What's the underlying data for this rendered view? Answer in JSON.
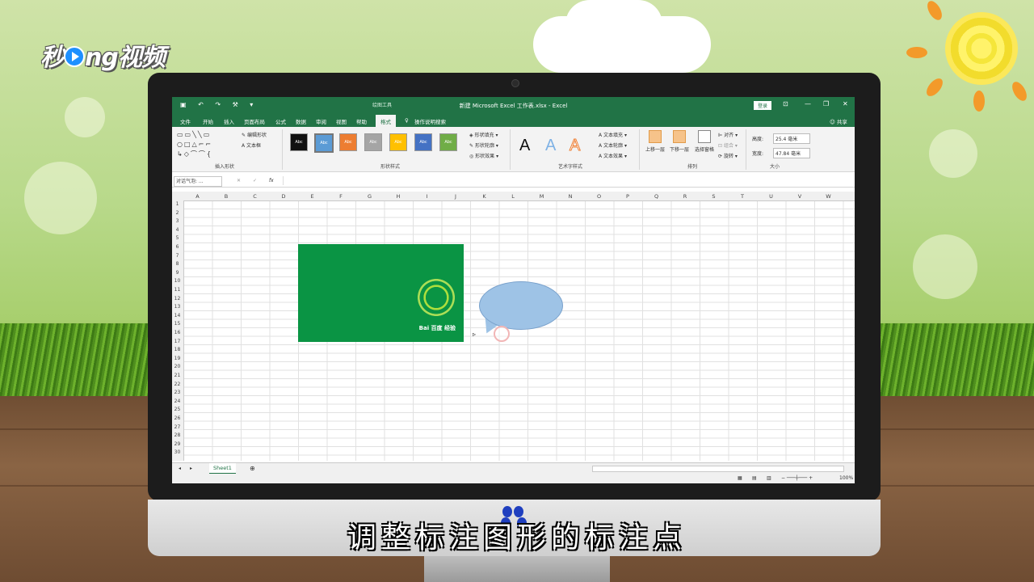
{
  "brand": {
    "logo": "秒dng视频"
  },
  "subtitle": "调整标注图形的标注点",
  "excel": {
    "window_title": "新建 Microsoft Excel 工作表.xlsx  -  Excel",
    "context_tab_group": "绘图工具",
    "login_label": "登录",
    "share_label": "共享",
    "tabs": [
      "文件",
      "开始",
      "插入",
      "页面布局",
      "公式",
      "数据",
      "审阅",
      "视图",
      "帮助",
      "格式"
    ],
    "active_tab": "格式",
    "tell_me": "操作说明搜索",
    "ribbon": {
      "insert_shapes": {
        "label": "插入形状",
        "edit_shape": "编辑形状",
        "text_box": "文本框"
      },
      "shape_styles": {
        "label": "形状样式",
        "thumb_text": "Abc",
        "fill": "形状填充",
        "outline": "形状轮廓",
        "effects": "形状效果"
      },
      "wordart": {
        "label": "艺术字样式",
        "text_fill": "文本填充",
        "text_outline": "文本轮廓",
        "text_effects": "文本效果"
      },
      "arrange": {
        "label": "排列",
        "bring_forward": "上移一层",
        "send_backward": "下移一层",
        "selection_pane": "选择窗格",
        "align": "对齐",
        "group": "组合",
        "rotate": "旋转"
      },
      "size": {
        "label": "大小",
        "height_label": "高度:",
        "height_value": "25.4 毫米",
        "width_label": "宽度:",
        "width_value": "47.84 毫米"
      }
    },
    "name_box": "对话气泡: ...",
    "fx": "fx",
    "columns": [
      "A",
      "B",
      "C",
      "D",
      "E",
      "F",
      "G",
      "H",
      "I",
      "J",
      "K",
      "L",
      "M",
      "N",
      "O",
      "P",
      "Q",
      "R",
      "S",
      "T",
      "U",
      "V",
      "W"
    ],
    "rows": [
      "1",
      "2",
      "3",
      "4",
      "5",
      "6",
      "7",
      "8",
      "9",
      "10",
      "11",
      "12",
      "13",
      "14",
      "15",
      "16",
      "17",
      "18",
      "19",
      "20",
      "21",
      "22",
      "23",
      "24",
      "25",
      "26",
      "27",
      "28",
      "29",
      "30"
    ],
    "image_brand": "Bai 百度 经验",
    "sheet_tab": "Sheet1",
    "zoom": "100%"
  },
  "colors": {
    "excel_green": "#217346",
    "picture_green": "#0a9444",
    "callout_fill": "#9ec3e6"
  }
}
